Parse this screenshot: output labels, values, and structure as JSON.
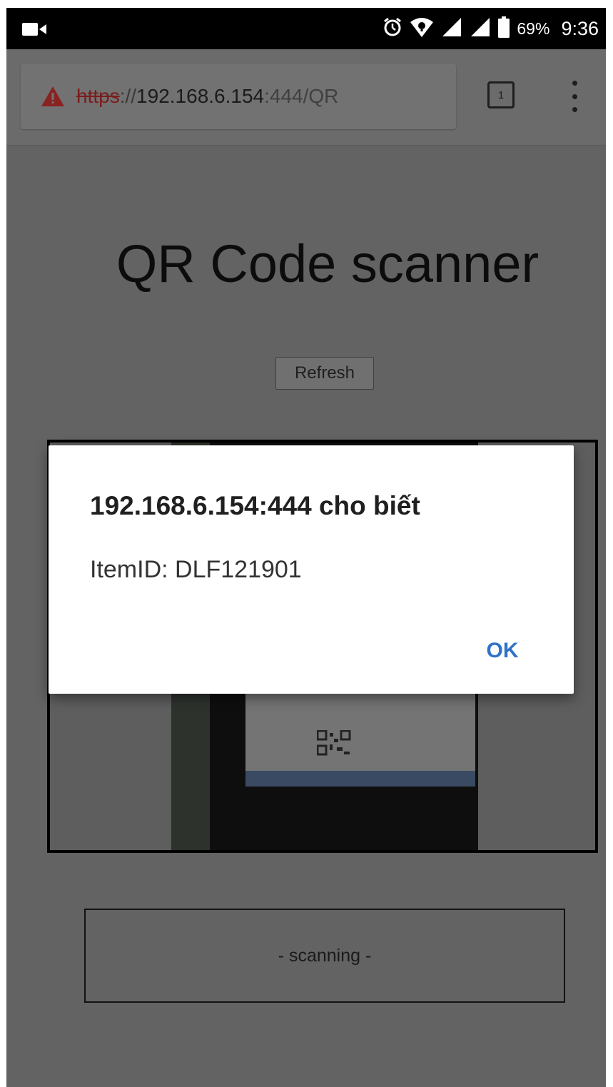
{
  "status_bar": {
    "battery_percent": "69%",
    "time": "9:36",
    "icons": [
      "video-camera-icon",
      "alarm-clock-icon",
      "wifi-icon",
      "cell-signal-icon",
      "cell-signal-icon",
      "battery-icon"
    ]
  },
  "browser": {
    "url_scheme": "https",
    "url_separator": "://",
    "url_host": "192.168.6.154",
    "url_rest": ":444/QR",
    "security_icon": "warning-triangle-icon",
    "tab_count": "1",
    "menu_icon": "overflow-menu-icon",
    "warning_color": "#8a2222"
  },
  "page": {
    "title": "QR Code scanner",
    "refresh_label": "Refresh",
    "scan_status": "- scanning -"
  },
  "dialog": {
    "title": "192.168.6.154:444 cho biết",
    "message": "ItemID: DLF121901",
    "ok_label": "OK",
    "accent_color": "#2f72c8"
  }
}
